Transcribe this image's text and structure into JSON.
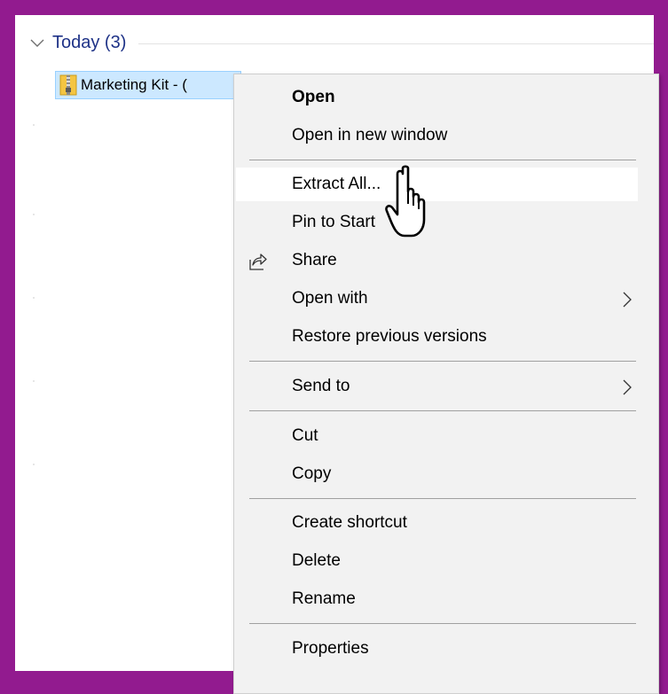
{
  "group": {
    "title": "Today (3)"
  },
  "file": {
    "name": "Marketing Kit - ("
  },
  "menu": {
    "items": [
      {
        "label": "Open",
        "bold": true
      },
      {
        "label": "Open in new window"
      },
      {
        "label": "Extract All...",
        "highlighted": true
      },
      {
        "label": "Pin to Start"
      },
      {
        "label": "Share",
        "icon": "share-icon"
      },
      {
        "label": "Open with",
        "submenu": true
      },
      {
        "label": "Restore previous versions"
      },
      {
        "label": "Send to",
        "submenu": true
      },
      {
        "label": "Cut"
      },
      {
        "label": "Copy"
      },
      {
        "label": "Create shortcut"
      },
      {
        "label": "Delete"
      },
      {
        "label": "Rename"
      },
      {
        "label": "Properties"
      }
    ]
  },
  "colors": {
    "frame": "#921b8f",
    "group_title": "#1e3287",
    "selection": "#cce8ff",
    "menu_background": "#f2f2f2",
    "menu_highlight": "#ffffff"
  },
  "cursor": "hand-pointer-cursor"
}
